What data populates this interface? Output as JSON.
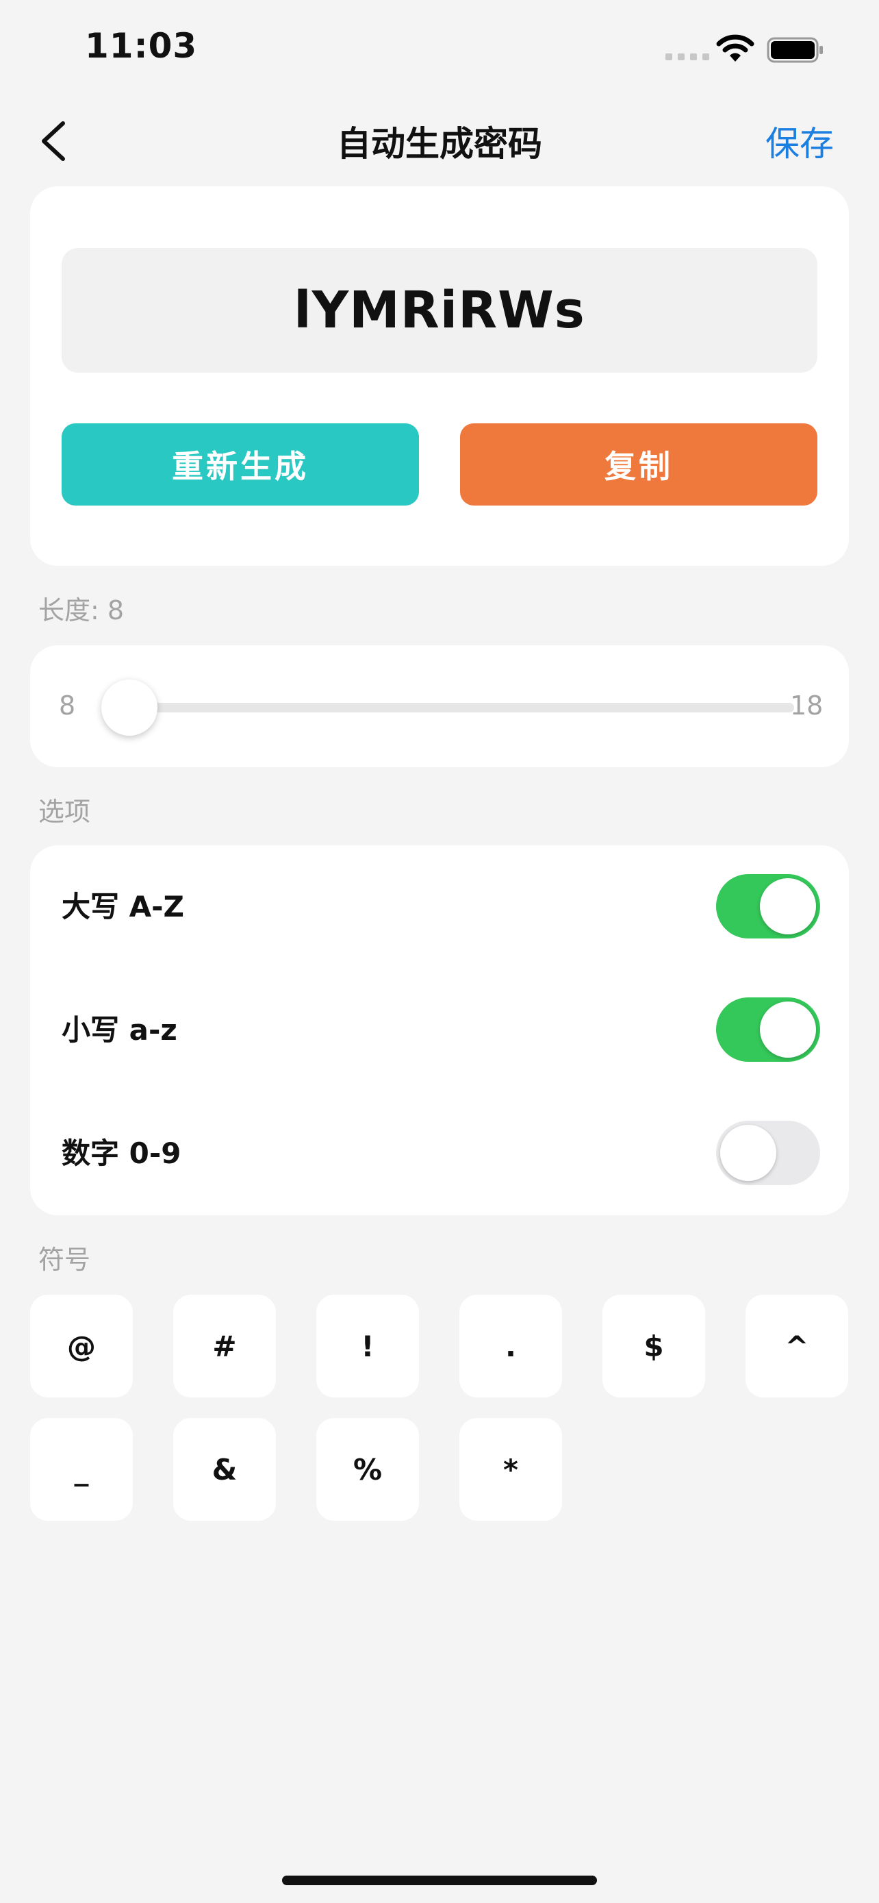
{
  "status_bar": {
    "time": "11:03"
  },
  "nav": {
    "title": "自动生成密码",
    "save_label": "保存"
  },
  "password": {
    "value": "lYMRiRWs"
  },
  "buttons": {
    "regenerate": "重新生成",
    "copy": "复制"
  },
  "length": {
    "label": "长度: 8",
    "min": "8",
    "max": "18",
    "value": 8
  },
  "options": {
    "section_label": "选项",
    "items": [
      {
        "label": "大写 A-Z",
        "enabled": true
      },
      {
        "label": "小写 a-z",
        "enabled": true
      },
      {
        "label": "数字 0-9",
        "enabled": false
      }
    ]
  },
  "symbols": {
    "section_label": "符号",
    "items": [
      "@",
      "#",
      "!",
      ".",
      "$",
      "^",
      "_",
      "&",
      "%",
      "*"
    ]
  },
  "colors": {
    "accent": "#1a7fe0",
    "regenerate": "#2ac8c3",
    "copy": "#ef793c",
    "toggle_on": "#34c759"
  }
}
